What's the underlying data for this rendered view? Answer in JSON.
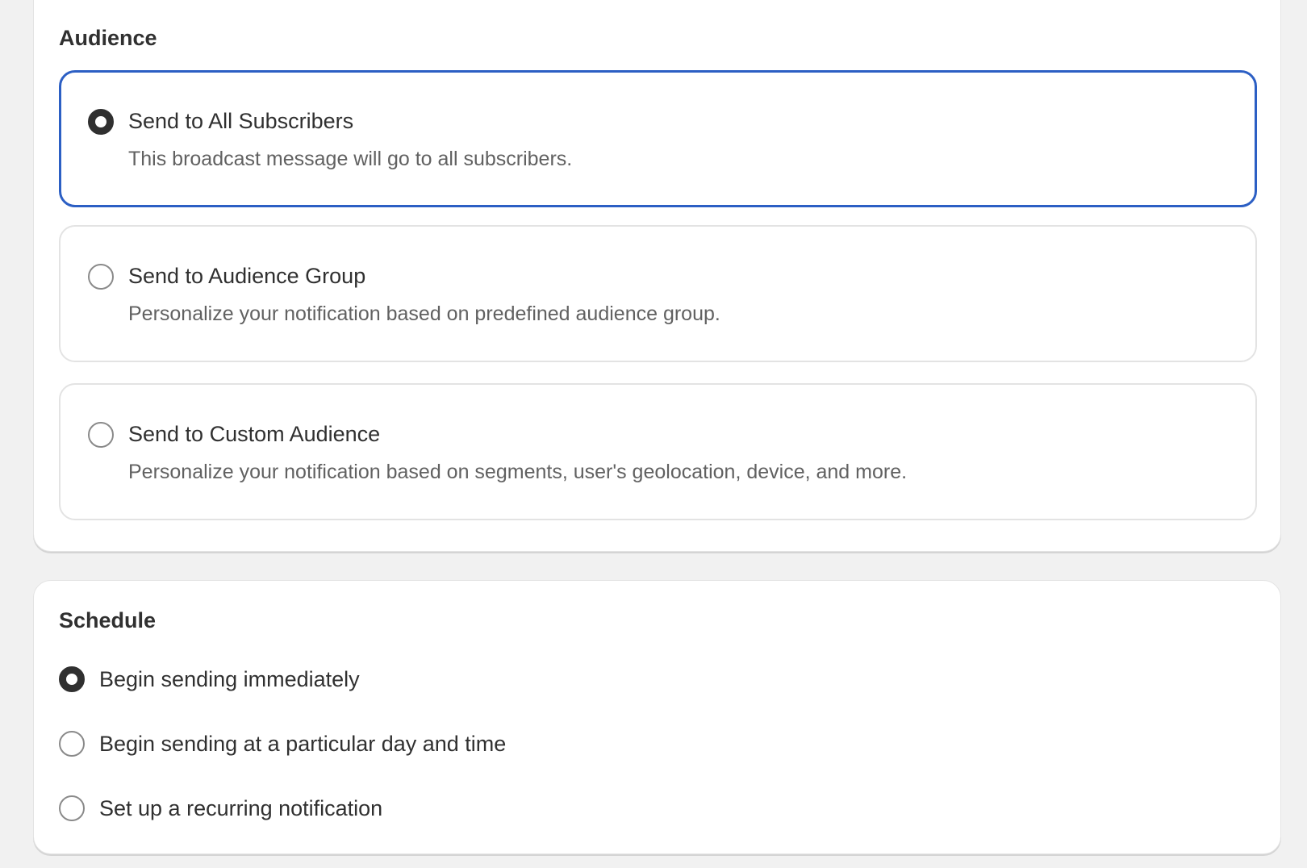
{
  "audience": {
    "title": "Audience",
    "options": [
      {
        "label": "Send to All Subscribers",
        "description": "This broadcast message will go to all subscribers.",
        "selected": true
      },
      {
        "label": "Send to Audience Group",
        "description": "Personalize your notification based on predefined audience group.",
        "selected": false
      },
      {
        "label": "Send to Custom Audience",
        "description": "Personalize your notification based on segments, user's geolocation, device, and more.",
        "selected": false
      }
    ]
  },
  "schedule": {
    "title": "Schedule",
    "options": [
      {
        "label": "Begin sending immediately",
        "selected": true
      },
      {
        "label": "Begin sending at a particular day and time",
        "selected": false
      },
      {
        "label": "Set up a recurring notification",
        "selected": false
      }
    ]
  },
  "colors": {
    "accent": "#2c5fc4",
    "background": "#f1f1f1",
    "card": "#ffffff",
    "text": "#303030",
    "muted_text": "#616161"
  }
}
